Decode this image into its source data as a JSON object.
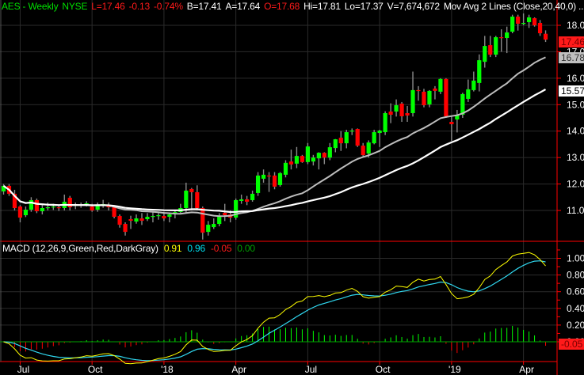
{
  "header": {
    "symbol": "AES - Weekly",
    "exchange": "NYSE",
    "last": "L=17.46",
    "change": "-0.13",
    "change_pct": "-0.74%",
    "bid": "B=17.41",
    "ask": "A=17.64",
    "open": "O=17.68",
    "high": "Hi=17.81",
    "low": "Lo=17.37",
    "volume": "V=7,674,672",
    "study": "Mov Avg 2 Lines (Close,20,40,0) ..."
  },
  "macd_header": {
    "label": "MACD (12,26,9,Green,Red,DarkGray)",
    "macd": "0.91",
    "signal": "0.96",
    "histogram": "-0.05",
    "zero": "0.00"
  },
  "price_tags": {
    "last": "17.46",
    "ma20": "16.78",
    "ma40": "15.57",
    "macd_hist": "-0.05"
  },
  "colors": {
    "up": "#00ff00",
    "down": "#ff0000",
    "wick": "#8a8a8a",
    "ma20": "#bdbdbd",
    "ma40": "#ffffff",
    "macd": "#ffff00",
    "signal": "#30d8f0",
    "axis": "#ff0000",
    "grid": "#2b2b2b"
  },
  "chart_data": [
    {
      "type": "candlestick",
      "title": "AES - Weekly",
      "ylim": [
        10.0,
        18.5
      ],
      "grid": true,
      "y_ticks": [
        "11.00",
        "12.00",
        "13.00",
        "14.00",
        "15.00",
        "16.00",
        "17.00",
        "18.00"
      ],
      "x_ticks": [
        {
          "label": "Jul",
          "at_index": 3
        },
        {
          "label": "Oct",
          "at_index": 16
        },
        {
          "label": "'18",
          "at_index": 29
        },
        {
          "label": "Apr",
          "at_index": 42
        },
        {
          "label": "Jul",
          "at_index": 55
        },
        {
          "label": "Oct",
          "at_index": 68
        },
        {
          "label": "'19",
          "at_index": 81
        },
        {
          "label": "Apr",
          "at_index": 94
        }
      ],
      "series": [
        {
          "name": "Mov Avg 20",
          "period": 20,
          "type": "line",
          "last": 16.78
        },
        {
          "name": "Mov Avg 40",
          "period": 40,
          "type": "line",
          "last": 15.57
        }
      ],
      "ohlc": [
        [
          11.72,
          12.0,
          11.6,
          11.93
        ],
        [
          11.93,
          12.0,
          11.55,
          11.63
        ],
        [
          11.63,
          11.78,
          11.0,
          11.09
        ],
        [
          11.15,
          11.2,
          10.55,
          10.73
        ],
        [
          10.82,
          11.15,
          10.75,
          11.03
        ],
        [
          11.03,
          11.5,
          10.95,
          11.39
        ],
        [
          11.39,
          11.45,
          10.9,
          10.97
        ],
        [
          10.97,
          11.2,
          10.85,
          11.09
        ],
        [
          11.09,
          11.3,
          11.0,
          11.12
        ],
        [
          11.12,
          11.25,
          11.02,
          11.15
        ],
        [
          11.12,
          11.2,
          10.98,
          11.09
        ],
        [
          11.09,
          11.6,
          11.0,
          11.33
        ],
        [
          11.48,
          11.55,
          11.0,
          11.12
        ],
        [
          11.18,
          11.3,
          11.05,
          11.21
        ],
        [
          11.21,
          11.3,
          11.1,
          11.18
        ],
        [
          11.24,
          11.35,
          11.15,
          11.27
        ],
        [
          11.15,
          11.25,
          10.95,
          11.0
        ],
        [
          11.03,
          11.3,
          10.95,
          11.21
        ],
        [
          11.21,
          11.4,
          11.1,
          11.24
        ],
        [
          11.21,
          11.3,
          11.0,
          11.12
        ],
        [
          11.12,
          11.15,
          10.7,
          10.76
        ],
        [
          10.79,
          10.85,
          10.35,
          10.46
        ],
        [
          10.49,
          10.55,
          10.05,
          10.19
        ],
        [
          10.67,
          10.8,
          10.3,
          10.61
        ],
        [
          10.58,
          10.85,
          10.5,
          10.7
        ],
        [
          10.7,
          10.9,
          10.45,
          10.61
        ],
        [
          10.67,
          10.9,
          10.6,
          10.76
        ],
        [
          10.76,
          10.95,
          10.55,
          10.79
        ],
        [
          10.79,
          10.95,
          10.65,
          10.82
        ],
        [
          10.79,
          10.95,
          10.6,
          10.7
        ],
        [
          10.76,
          10.9,
          10.55,
          10.85
        ],
        [
          10.91,
          11.0,
          10.7,
          10.94
        ],
        [
          10.94,
          11.25,
          10.9,
          11.09
        ],
        [
          11.09,
          12.05,
          10.9,
          11.75
        ],
        [
          11.81,
          11.85,
          11.0,
          11.69
        ],
        [
          11.69,
          11.95,
          11.0,
          11.09
        ],
        [
          11.09,
          11.15,
          9.9,
          10.16
        ],
        [
          10.19,
          10.6,
          10.05,
          10.46
        ],
        [
          10.37,
          10.7,
          10.3,
          10.49
        ],
        [
          10.49,
          10.9,
          10.4,
          10.76
        ],
        [
          10.91,
          11.25,
          10.6,
          10.82
        ],
        [
          10.85,
          11.0,
          10.55,
          10.73
        ],
        [
          10.73,
          11.45,
          10.65,
          11.39
        ],
        [
          11.36,
          11.6,
          11.25,
          11.42
        ],
        [
          11.42,
          11.55,
          11.2,
          11.33
        ],
        [
          11.39,
          11.75,
          11.33,
          11.63
        ],
        [
          11.66,
          12.45,
          11.55,
          12.32
        ],
        [
          12.2,
          12.55,
          12.05,
          12.35
        ],
        [
          12.32,
          12.45,
          11.7,
          12.29
        ],
        [
          12.32,
          12.45,
          11.8,
          11.9
        ],
        [
          11.96,
          12.45,
          11.9,
          12.41
        ],
        [
          12.35,
          12.9,
          12.25,
          12.8
        ],
        [
          12.85,
          13.3,
          12.55,
          12.74
        ],
        [
          12.77,
          13.4,
          12.6,
          13.06
        ],
        [
          13.06,
          13.1,
          12.8,
          12.83
        ],
        [
          12.83,
          13.55,
          12.75,
          13.42
        ],
        [
          12.85,
          13.1,
          12.7,
          13.0
        ],
        [
          12.97,
          13.2,
          12.55,
          13.18
        ],
        [
          13.18,
          13.2,
          12.75,
          13.0
        ],
        [
          13.0,
          13.55,
          12.9,
          13.39
        ],
        [
          13.36,
          13.7,
          13.2,
          13.69
        ],
        [
          13.75,
          14.0,
          13.25,
          13.54
        ],
        [
          13.54,
          14.05,
          13.35,
          13.96
        ],
        [
          13.99,
          14.1,
          13.85,
          14.02
        ],
        [
          14.08,
          14.1,
          13.4,
          13.45
        ],
        [
          13.45,
          13.55,
          13.05,
          13.09
        ],
        [
          13.15,
          13.65,
          13.0,
          13.57
        ],
        [
          13.54,
          14.05,
          13.5,
          13.96
        ],
        [
          13.93,
          14.05,
          13.4,
          14.02
        ],
        [
          13.96,
          14.75,
          13.85,
          14.68
        ],
        [
          14.74,
          15.05,
          14.3,
          14.62
        ],
        [
          14.74,
          15.2,
          14.55,
          14.98
        ],
        [
          15.04,
          15.1,
          14.35,
          14.56
        ],
        [
          14.68,
          14.95,
          14.35,
          14.59
        ],
        [
          14.68,
          16.25,
          14.55,
          15.55
        ],
        [
          15.55,
          15.7,
          15.15,
          15.52
        ],
        [
          15.49,
          15.6,
          14.9,
          14.98
        ],
        [
          15.01,
          15.55,
          14.9,
          15.52
        ],
        [
          15.61,
          15.7,
          15.2,
          15.52
        ],
        [
          15.49,
          16.0,
          15.4,
          15.97
        ],
        [
          15.97,
          16.0,
          14.5,
          14.56
        ],
        [
          14.35,
          14.55,
          13.63,
          14.26
        ],
        [
          14.44,
          14.8,
          13.95,
          14.62
        ],
        [
          14.62,
          15.45,
          14.5,
          15.4
        ],
        [
          15.22,
          15.95,
          15.1,
          15.58
        ],
        [
          15.55,
          16.25,
          15.5,
          15.91
        ],
        [
          15.82,
          16.9,
          15.5,
          16.68
        ],
        [
          16.62,
          17.6,
          16.4,
          17.22
        ],
        [
          17.25,
          17.6,
          16.8,
          16.89
        ],
        [
          16.89,
          17.6,
          16.8,
          17.55
        ],
        [
          17.55,
          17.85,
          17.0,
          17.52
        ],
        [
          17.52,
          17.95,
          16.95,
          17.73
        ],
        [
          17.76,
          18.4,
          17.7,
          18.33
        ],
        [
          18.33,
          18.4,
          17.8,
          18.06
        ],
        [
          18.06,
          18.45,
          18.0,
          18.09
        ],
        [
          18.12,
          18.4,
          17.9,
          18.3
        ],
        [
          18.27,
          18.3,
          17.95,
          18.0
        ],
        [
          18.09,
          18.2,
          17.6,
          17.7
        ],
        [
          17.68,
          17.81,
          17.37,
          17.46
        ]
      ]
    },
    {
      "type": "line",
      "title": "MACD (12,26,9,Green,Red,DarkGray)",
      "params": {
        "fast": 12,
        "slow": 26,
        "signal": 9
      },
      "ylim": [
        -0.12,
        1.2
      ],
      "y_ticks": [
        "0.00",
        "0.20",
        "0.40",
        "0.60",
        "0.80",
        "1.00"
      ],
      "series": [
        {
          "name": "MACD",
          "last": 0.91
        },
        {
          "name": "Signal",
          "last": 0.96
        },
        {
          "name": "Histogram",
          "type": "bar",
          "last": -0.05
        }
      ]
    }
  ]
}
